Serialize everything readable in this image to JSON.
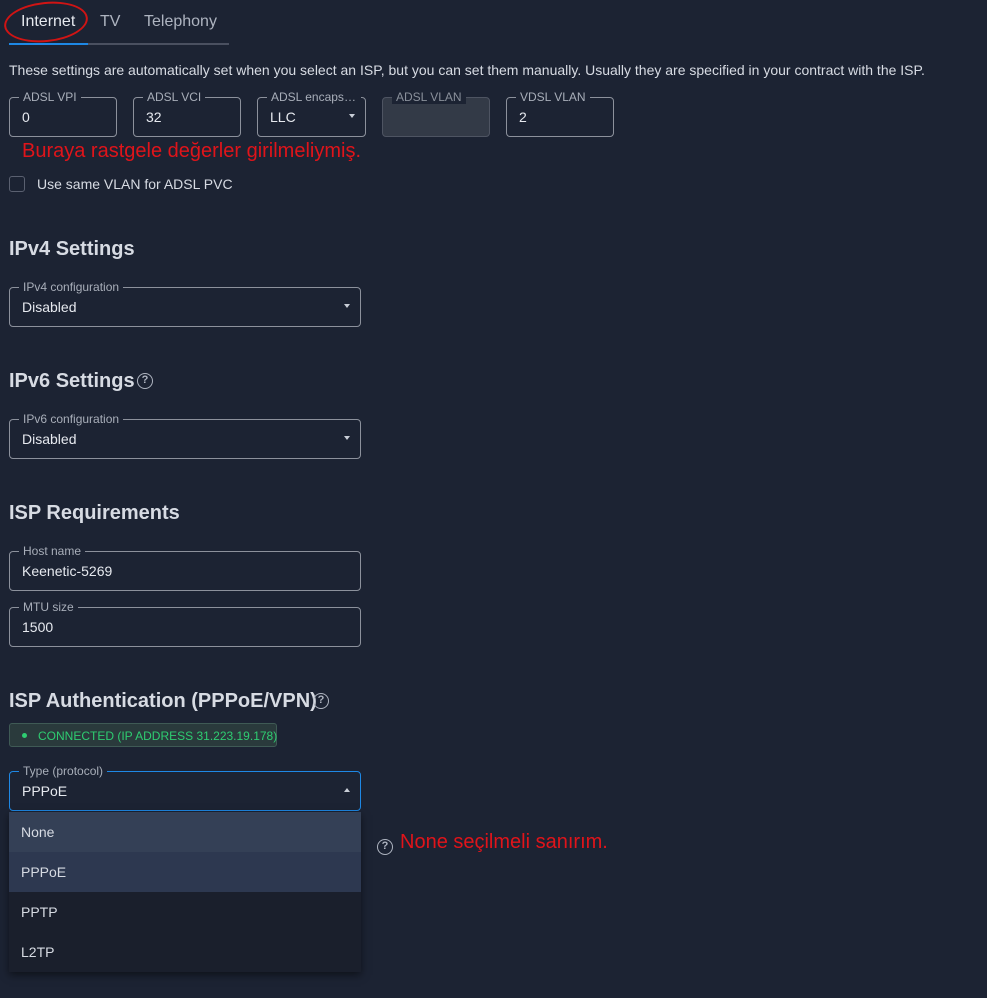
{
  "tabs": [
    {
      "label": "Internet",
      "active": true
    },
    {
      "label": "TV",
      "active": false
    },
    {
      "label": "Telephony",
      "active": false
    }
  ],
  "description": "These settings are automatically set when you select an ISP, but you can set them manually. Usually they are specified in your contract with the ISP.",
  "adsl": {
    "vpi": {
      "label": "ADSL VPI",
      "value": "0"
    },
    "vci": {
      "label": "ADSL VCI",
      "value": "32"
    },
    "encapsulation": {
      "label": "ADSL encapsul...",
      "value": "LLC"
    },
    "vlan": {
      "label": "ADSL VLAN",
      "value": ""
    },
    "vdsl_vlan": {
      "label": "VDSL VLAN",
      "value": "2"
    }
  },
  "annotation_top": "Buraya rastgele değerler girilmeliymiş.",
  "same_vlan_checkbox": {
    "label": "Use same VLAN for ADSL PVC",
    "checked": false
  },
  "ipv4": {
    "heading": "IPv4 Settings",
    "config": {
      "label": "IPv4 configuration",
      "value": "Disabled"
    }
  },
  "ipv6": {
    "heading": "IPv6 Settings",
    "config": {
      "label": "IPv6 configuration",
      "value": "Disabled"
    }
  },
  "isp_requirements": {
    "heading": "ISP Requirements",
    "host_name": {
      "label": "Host name",
      "value": "Keenetic-5269"
    },
    "mtu": {
      "label": "MTU size",
      "value": "1500"
    }
  },
  "isp_auth": {
    "heading": "ISP Authentication (PPPoE/VPN)",
    "status": "CONNECTED (IP ADDRESS 31.223.19.178)",
    "type": {
      "label": "Type (protocol)",
      "value": "PPPoE"
    },
    "options": [
      "None",
      "PPPoE",
      "PPTP",
      "L2TP"
    ]
  },
  "annotation_bottom": "None seçilmeli sanırım.",
  "help_icon": "?",
  "colors": {
    "background": "#1c2333",
    "accent": "#1e88e5",
    "annotation": "#e0141a",
    "connected": "#2ecc71"
  }
}
